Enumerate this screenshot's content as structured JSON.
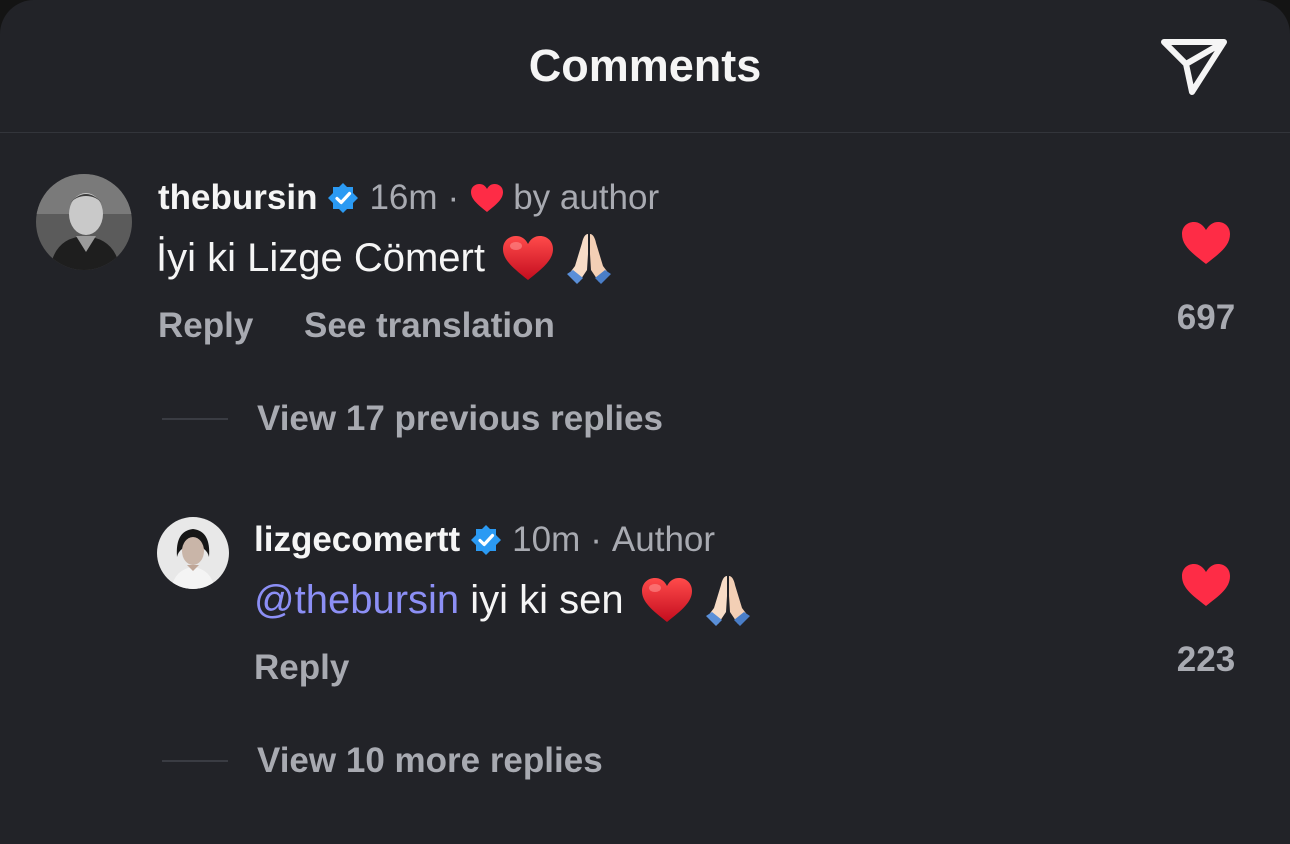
{
  "header": {
    "title": "Comments",
    "share_icon": "paper-plane-icon"
  },
  "colors": {
    "background": "#222328",
    "like_red": "#fe2c46",
    "verified_blue": "#2b9af3",
    "mention": "#8c8ff5",
    "muted_text": "#a8aab1"
  },
  "comments": [
    {
      "username": "thebursin",
      "verified": true,
      "time": "16m",
      "separator": "·",
      "liked_by_author_label": "by author",
      "text": "İyi ki Lizge Cömert",
      "emojis": [
        "red-heart",
        "folded-hands"
      ],
      "actions": {
        "reply": "Reply",
        "translate": "See translation"
      },
      "likes": "697"
    }
  ],
  "threads": {
    "view_previous": "View 17 previous replies",
    "view_more": "View 10 more replies"
  },
  "replies": [
    {
      "username": "lizgecomertt",
      "verified": true,
      "time": "10m",
      "separator": "·",
      "role": "Author",
      "mention": "@thebursin",
      "text": " iyi ki sen",
      "emojis": [
        "red-heart",
        "folded-hands"
      ],
      "actions": {
        "reply": "Reply"
      },
      "likes": "223"
    }
  ]
}
